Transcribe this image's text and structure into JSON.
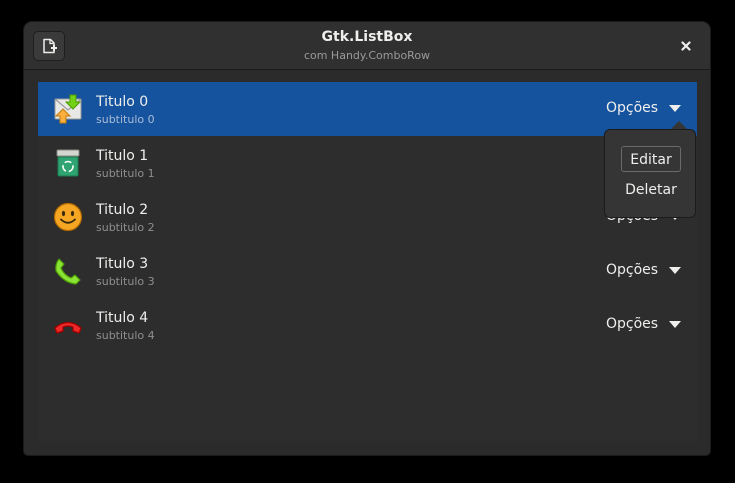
{
  "window": {
    "title": "Gtk.ListBox",
    "subtitle": "com Handy.ComboRow",
    "new_button_icon": "document-new-icon",
    "close_icon": "close-icon"
  },
  "rows": [
    {
      "title": "Titulo 0",
      "subtitle": "subtitulo 0",
      "icon": "mail-send-receive-icon",
      "combo": "Opções",
      "selected": true
    },
    {
      "title": "Titulo 1",
      "subtitle": "subtitulo 1",
      "icon": "recycle-bin-icon",
      "combo": "Opções",
      "selected": false
    },
    {
      "title": "Titulo 2",
      "subtitle": "subtitulo 2",
      "icon": "smiley-face-icon",
      "combo": "Opções",
      "selected": false
    },
    {
      "title": "Titulo 3",
      "subtitle": "subtitulo 3",
      "icon": "phone-call-icon",
      "combo": "Opções",
      "selected": false
    },
    {
      "title": "Titulo 4",
      "subtitle": "subtitulo 4",
      "icon": "phone-hangup-icon",
      "combo": "Opções",
      "selected": false
    }
  ],
  "popover": {
    "items": [
      {
        "label": "Editar",
        "focused": true
      },
      {
        "label": "Deletar",
        "focused": false
      }
    ]
  },
  "colors": {
    "selected_row": "#15539e",
    "background": "#2d2d2d"
  }
}
